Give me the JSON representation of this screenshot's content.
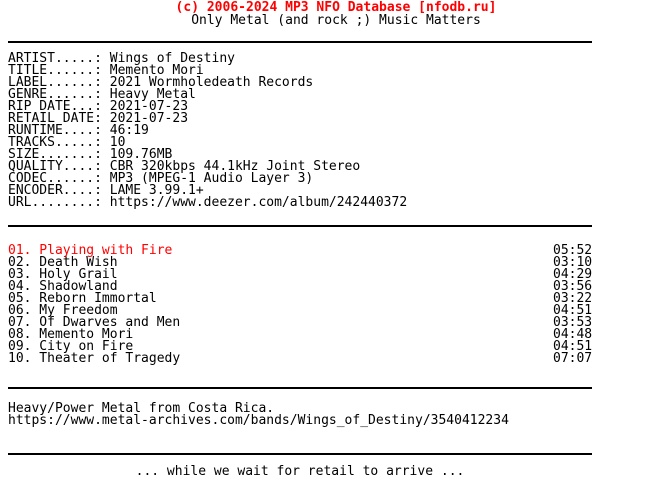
{
  "header": {
    "title": "(c) 2006-2024 MP3 NFO Database [nfodb.ru]",
    "subtitle": "Only Metal (and rock ;) Music Matters",
    "title_color": "#ff0000",
    "subtitle_color": "#000000"
  },
  "metadata": {
    "rows": [
      {
        "label": "ARTIST.....:",
        "value": "Wings of Destiny"
      },
      {
        "label": "TITLE......:",
        "value": "Memento Mori"
      },
      {
        "label": "LABEL......:",
        "value": "2021 Wormholedeath Records"
      },
      {
        "label": "GENRE......:",
        "value": "Heavy Metal"
      },
      {
        "label": "RIP DATE...:",
        "value": "2021-07-23"
      },
      {
        "label": "RETAIL DATE:",
        "value": "2021-07-23"
      },
      {
        "label": "RUNTIME....:",
        "value": "46:19"
      },
      {
        "label": "TRACKS.....:",
        "value": "10"
      },
      {
        "label": "SIZE.......:",
        "value": "109.76MB"
      },
      {
        "label": "QUALITY....:",
        "value": "CBR 320kbps 44.1kHz Joint Stereo"
      },
      {
        "label": "CODEC......:",
        "value": "MP3 (MPEG-1 Audio Layer 3)"
      },
      {
        "label": "ENCODER....:",
        "value": "LAME 3.99.1+"
      },
      {
        "label": "URL........:",
        "value": "https://www.deezer.com/album/242440372"
      }
    ]
  },
  "tracklist": {
    "tracks": [
      {
        "main": "01. Playing with Fire",
        "time": "05:52",
        "highlight": true
      },
      {
        "main": "02. Death Wish",
        "time": "03:10",
        "highlight": false
      },
      {
        "main": "03. Holy Grail",
        "time": "04:29",
        "highlight": false
      },
      {
        "main": "04. Shadowland",
        "time": "03:56",
        "highlight": false
      },
      {
        "main": "05. Reborn Immortal",
        "time": "03:22",
        "highlight": false
      },
      {
        "main": "06. My Freedom",
        "time": "04:51",
        "highlight": false
      },
      {
        "main": "07. Of Dwarves and Men",
        "time": "03:53",
        "highlight": false
      },
      {
        "main": "08. Memento Mori",
        "time": "04:48",
        "highlight": false
      },
      {
        "main": "09. City on Fire",
        "time": "04:51",
        "highlight": false
      },
      {
        "main": "10. Theater of Tragedy",
        "time": "07:07",
        "highlight": false
      }
    ]
  },
  "notes": {
    "lines": [
      "Heavy/Power Metal from Costa Rica.",
      "https://www.metal-archives.com/bands/Wings_of_Destiny/3540412234"
    ]
  },
  "footer": {
    "message": "... while we wait for retail to arrive ..."
  }
}
